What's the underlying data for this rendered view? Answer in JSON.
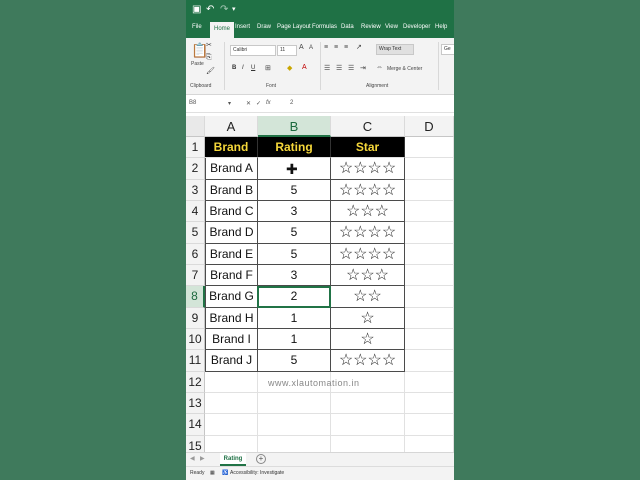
{
  "titlebar": {
    "save_icon": "save-icon",
    "undo_icon": "undo-icon",
    "redo_icon": "redo-icon"
  },
  "tabs": [
    "File",
    "Home",
    "Insert",
    "Draw",
    "Page Layout",
    "Formulas",
    "Data",
    "Review",
    "View",
    "Developer",
    "Help"
  ],
  "ribbon": {
    "paste": "Paste",
    "font_name": "Calibri",
    "font_size": "11",
    "bold": "B",
    "italic": "I",
    "underline": "U",
    "wrap_text": "Wrap Text",
    "merge_center": "Merge & Center",
    "clipboard": "Clipboard",
    "font": "Font",
    "alignment": "Alignment",
    "number_format": "Ge"
  },
  "formula_bar": {
    "name_box": "B8",
    "fx": "fx",
    "value": "2"
  },
  "columns": [
    "A",
    "B",
    "C",
    "D"
  ],
  "rows": [
    "1",
    "2",
    "3",
    "4",
    "5",
    "6",
    "7",
    "8",
    "9",
    "10",
    "11",
    "12",
    "13",
    "14",
    "15"
  ],
  "table": {
    "headers": [
      "Brand",
      "Rating",
      "Star"
    ],
    "data": [
      {
        "brand": "Brand A",
        "rating": "",
        "star": "☆☆☆☆"
      },
      {
        "brand": "Brand B",
        "rating": "5",
        "star": "☆☆☆☆"
      },
      {
        "brand": "Brand C",
        "rating": "3",
        "star": "☆☆☆"
      },
      {
        "brand": "Brand D",
        "rating": "5",
        "star": "☆☆☆☆"
      },
      {
        "brand": "Brand E",
        "rating": "5",
        "star": "☆☆☆☆"
      },
      {
        "brand": "Brand F",
        "rating": "3",
        "star": "☆☆☆"
      },
      {
        "brand": "Brand G",
        "rating": "2",
        "star": "☆☆"
      },
      {
        "brand": "Brand H",
        "rating": "1",
        "star": "☆"
      },
      {
        "brand": "Brand I",
        "rating": "1",
        "star": "☆"
      },
      {
        "brand": "Brand J",
        "rating": "5",
        "star": "☆☆☆☆"
      }
    ]
  },
  "watermark": "www.xlautomation.in",
  "sheet_tab": "Rating",
  "status": {
    "ready": "Ready",
    "accessibility": "Accessibility: Investigate"
  },
  "colors": {
    "excel_green": "#1f7145",
    "header_bg": "#000000",
    "header_text": "#f5d73a",
    "page_bg": "#3f7a5c"
  }
}
